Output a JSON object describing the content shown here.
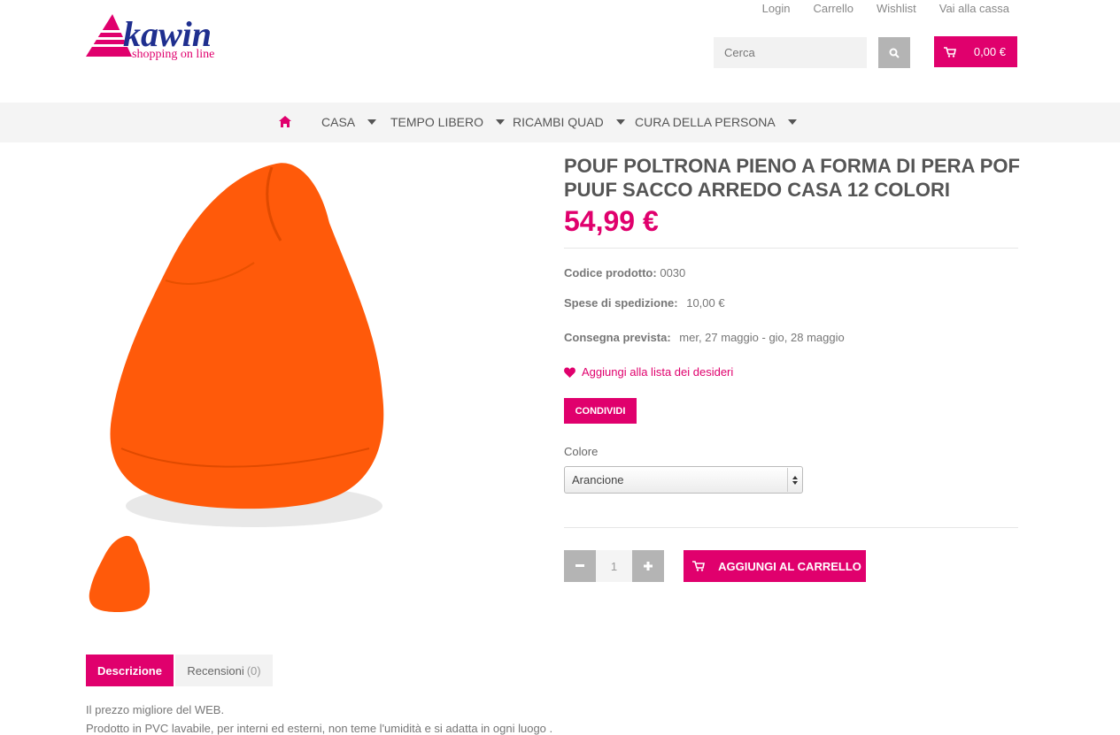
{
  "header": {
    "top_links": [
      "Login",
      "Carrello",
      "Wishlist",
      "Vai alla cassa"
    ],
    "logo_text": "kawin",
    "logo_tagline": "shopping on line",
    "search_placeholder": "Cerca",
    "cart_total": "0,00 €"
  },
  "nav": {
    "items": [
      "CASA",
      "TEMPO LIBERO",
      "RICAMBI QUAD",
      "CURA DELLA PERSONA"
    ]
  },
  "product": {
    "title": "POUF POLTRONA PIENO A FORMA DI PERA POF PUUF SACCO ARREDO CASA 12 COLORI",
    "price": "54,99 €",
    "code_label": "Codice prodotto:",
    "code_value": "0030",
    "shipping_label": "Spese di spedizione:",
    "shipping_value": "10,00 €",
    "delivery_label": "Consegna prevista:",
    "delivery_value": "mer, 27 maggio - gio, 28 maggio",
    "wishlist_label": "Aggiungi alla lista dei desideri",
    "share_label": "CONDIVIDI",
    "color_label": "Colore",
    "color_selected": "Arancione",
    "quantity": "1",
    "add_to_cart_label": "AGGIUNGI AL CARRELLO"
  },
  "tabs": {
    "description": "Descrizione",
    "reviews": "Recensioni",
    "reviews_count": "(0)"
  },
  "description": {
    "line1": "Il prezzo migliore del WEB.",
    "line2": "Prodotto in PVC lavabile, per interni ed esterni, non teme l'umidità e si adatta in ogni luogo ."
  },
  "colors": {
    "accent": "#e0006d",
    "product": "#ff5a0a"
  }
}
